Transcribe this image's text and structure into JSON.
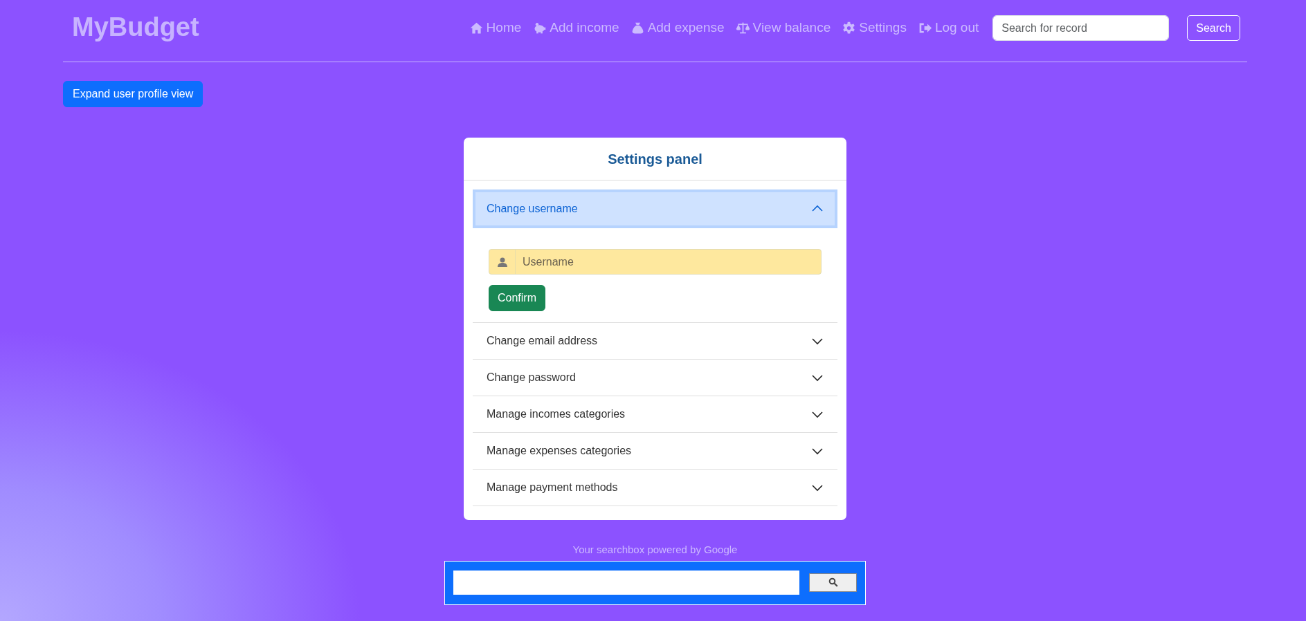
{
  "brand": "MyBudget",
  "nav": [
    {
      "label": "Home",
      "kind": "home"
    },
    {
      "label": "Add income",
      "kind": "income"
    },
    {
      "label": "Add expense",
      "kind": "expense"
    },
    {
      "label": "View balance",
      "kind": "balance"
    },
    {
      "label": "Settings",
      "kind": "settings"
    },
    {
      "label": "Log out",
      "kind": "logout"
    }
  ],
  "search": {
    "placeholder": "Search for record",
    "button": "Search"
  },
  "expand_button": "Expand user profile view",
  "panel": {
    "title": "Settings panel",
    "sections": [
      {
        "title": "Change username",
        "expanded": true,
        "form": {
          "placeholder": "Username",
          "button": "Confirm"
        }
      },
      {
        "title": "Change email address",
        "expanded": false
      },
      {
        "title": "Change password",
        "expanded": false
      },
      {
        "title": "Manage incomes categories",
        "expanded": false
      },
      {
        "title": "Manage expenses categories",
        "expanded": false
      },
      {
        "title": "Manage payment methods",
        "expanded": false
      }
    ]
  },
  "google": {
    "caption": "Your searchbox powered by Google"
  }
}
